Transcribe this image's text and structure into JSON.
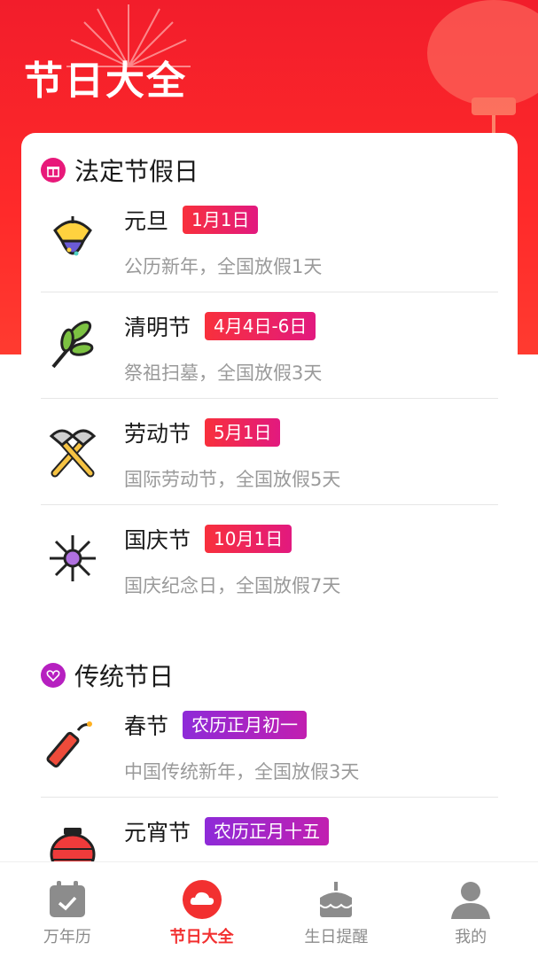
{
  "page": {
    "title": "节日大全"
  },
  "sections": [
    {
      "title": "法定节假日",
      "icon": "gift-icon",
      "color": "#e8197a",
      "items": [
        {
          "name": "元旦",
          "date": "1月1日",
          "desc": "公历新年，全国放假1天",
          "icon": "party-popper-icon"
        },
        {
          "name": "清明节",
          "date": "4月4日-6日",
          "desc": "祭祖扫墓，全国放假3天",
          "icon": "leaf-branch-icon"
        },
        {
          "name": "劳动节",
          "date": "5月1日",
          "desc": "国际劳动节，全国放假5天",
          "icon": "crossed-tools-icon"
        },
        {
          "name": "国庆节",
          "date": "10月1日",
          "desc": "国庆纪念日，全国放假7天",
          "icon": "firework-icon"
        }
      ]
    },
    {
      "title": "传统节日",
      "icon": "heart-icon",
      "color": "#b620c0",
      "items": [
        {
          "name": "春节",
          "date": "农历正月初一",
          "desc": "中国传统新年，全国放假3天",
          "icon": "firecracker-icon"
        },
        {
          "name": "元宵节",
          "date": "农历正月十五",
          "desc": "",
          "icon": "lantern-icon"
        }
      ]
    }
  ],
  "tabbar": {
    "tabs": [
      {
        "label": "万年历",
        "icon": "calendar-icon",
        "active": false
      },
      {
        "label": "节日大全",
        "icon": "cloud-icon",
        "active": true
      },
      {
        "label": "生日提醒",
        "icon": "cake-icon",
        "active": false
      },
      {
        "label": "我的",
        "icon": "user-icon",
        "active": false
      }
    ]
  },
  "colors": {
    "brand": "#f21d2b",
    "accent_red": "#f23030",
    "muted": "#9a9a9a"
  }
}
